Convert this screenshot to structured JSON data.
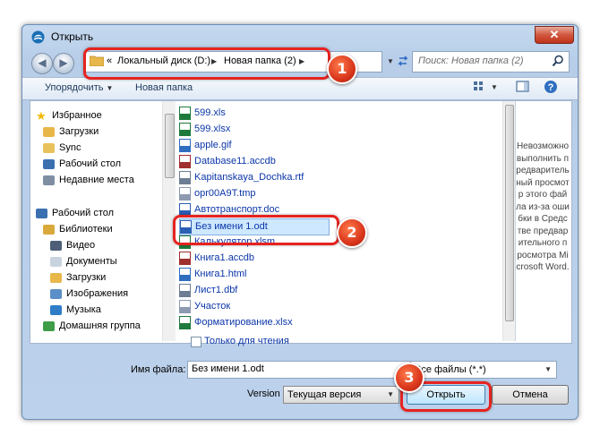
{
  "window": {
    "title": "Открыть",
    "close_label": "✕"
  },
  "navigation": {
    "back_icon": "back-arrow-icon",
    "forward_icon": "forward-arrow-icon",
    "breadcrumb_prefix": "«",
    "breadcrumbs": [
      "Локальный диск (D:)",
      "Новая папка (2)"
    ],
    "search_placeholder": "Поиск: Новая папка (2)"
  },
  "toolbar": {
    "organize_label": "Упорядочить",
    "new_folder_label": "Новая папка"
  },
  "sidebar": {
    "items": [
      {
        "label": "Избранное",
        "icon": "star-icon",
        "color": "#f2b705"
      },
      {
        "label": "Загрузки",
        "icon": "downloads-folder-icon",
        "color": "#e8b74a"
      },
      {
        "label": "Sync",
        "icon": "folder-icon",
        "color": "#e8c15c"
      },
      {
        "label": "Рабочий стол",
        "icon": "desktop-icon",
        "color": "#3a6fb0"
      },
      {
        "label": "Недавние места",
        "icon": "recent-places-icon",
        "color": "#7e8ea3"
      },
      {
        "label": "Рабочий стол",
        "icon": "desktop-icon",
        "color": "#3a6fb0"
      },
      {
        "label": "Библиотеки",
        "icon": "libraries-icon",
        "color": "#d9a93c"
      },
      {
        "label": "Видео",
        "icon": "video-icon",
        "color": "#4d5e76"
      },
      {
        "label": "Документы",
        "icon": "documents-icon",
        "color": "#c9d3df"
      },
      {
        "label": "Загрузки",
        "icon": "downloads-folder-icon",
        "color": "#e8b74a"
      },
      {
        "label": "Изображения",
        "icon": "pictures-icon",
        "color": "#5b8fc7"
      },
      {
        "label": "Музыка",
        "icon": "music-icon",
        "color": "#2f7cc7"
      },
      {
        "label": "Домашняя группа",
        "icon": "homegroup-icon",
        "color": "#3f9c47"
      }
    ]
  },
  "files": [
    {
      "name": "599.xls",
      "icon": "excel-file-icon",
      "color": "#1e7a3c"
    },
    {
      "name": "599.xlsx",
      "icon": "excel-file-icon",
      "color": "#1e7a3c"
    },
    {
      "name": "apple.gif",
      "icon": "image-file-icon",
      "color": "#2f6fc0"
    },
    {
      "name": "Database11.accdb",
      "icon": "access-file-icon",
      "color": "#a02f2f"
    },
    {
      "name": "Kapitanskaya_Dochka.rtf",
      "icon": "text-file-icon",
      "color": "#6d7d93"
    },
    {
      "name": "opr00A9T.tmp",
      "icon": "blank-file-icon",
      "color": "#8d9ab0"
    },
    {
      "name": "Автотранспорт.doc",
      "icon": "word-file-icon",
      "color": "#2b5fb4"
    },
    {
      "name": "Без имени 1.odt",
      "icon": "odt-file-icon",
      "color": "#2b5fb4"
    },
    {
      "name": "Калькулятор.xlsm",
      "icon": "excel-file-icon",
      "color": "#1e7a3c"
    },
    {
      "name": "Книга1.accdb",
      "icon": "access-file-icon",
      "color": "#a02f2f"
    },
    {
      "name": "Книга1.html",
      "icon": "html-file-icon",
      "color": "#2f6fc0"
    },
    {
      "name": "Лист1.dbf",
      "icon": "dbf-file-icon",
      "color": "#6d7d93"
    },
    {
      "name": "Участок",
      "icon": "blank-file-icon",
      "color": "#8d9ab0"
    },
    {
      "name": "Форматирование.xlsx",
      "icon": "excel-file-icon",
      "color": "#1e7a3c"
    }
  ],
  "selected_file_index": 7,
  "preview": {
    "message": "Невозможно выполнить предварительный просмотр этого файла из-за ошибки в Средстве предварительного просмотра Microsoft Word."
  },
  "readonly_label": "Только для чтения",
  "filename": {
    "label": "Имя файла:",
    "value": "Без имени 1.odt"
  },
  "filetype": {
    "value": "Все файлы (*.*)"
  },
  "version": {
    "label": "Version",
    "value": "Текущая версия"
  },
  "buttons": {
    "open_label": "Открыть",
    "cancel_label": "Отмена"
  },
  "callouts": [
    "1",
    "2",
    "3"
  ],
  "colors": {
    "callout": "#e6231f",
    "link_text": "#0b36a8",
    "close": "#c1321b"
  }
}
